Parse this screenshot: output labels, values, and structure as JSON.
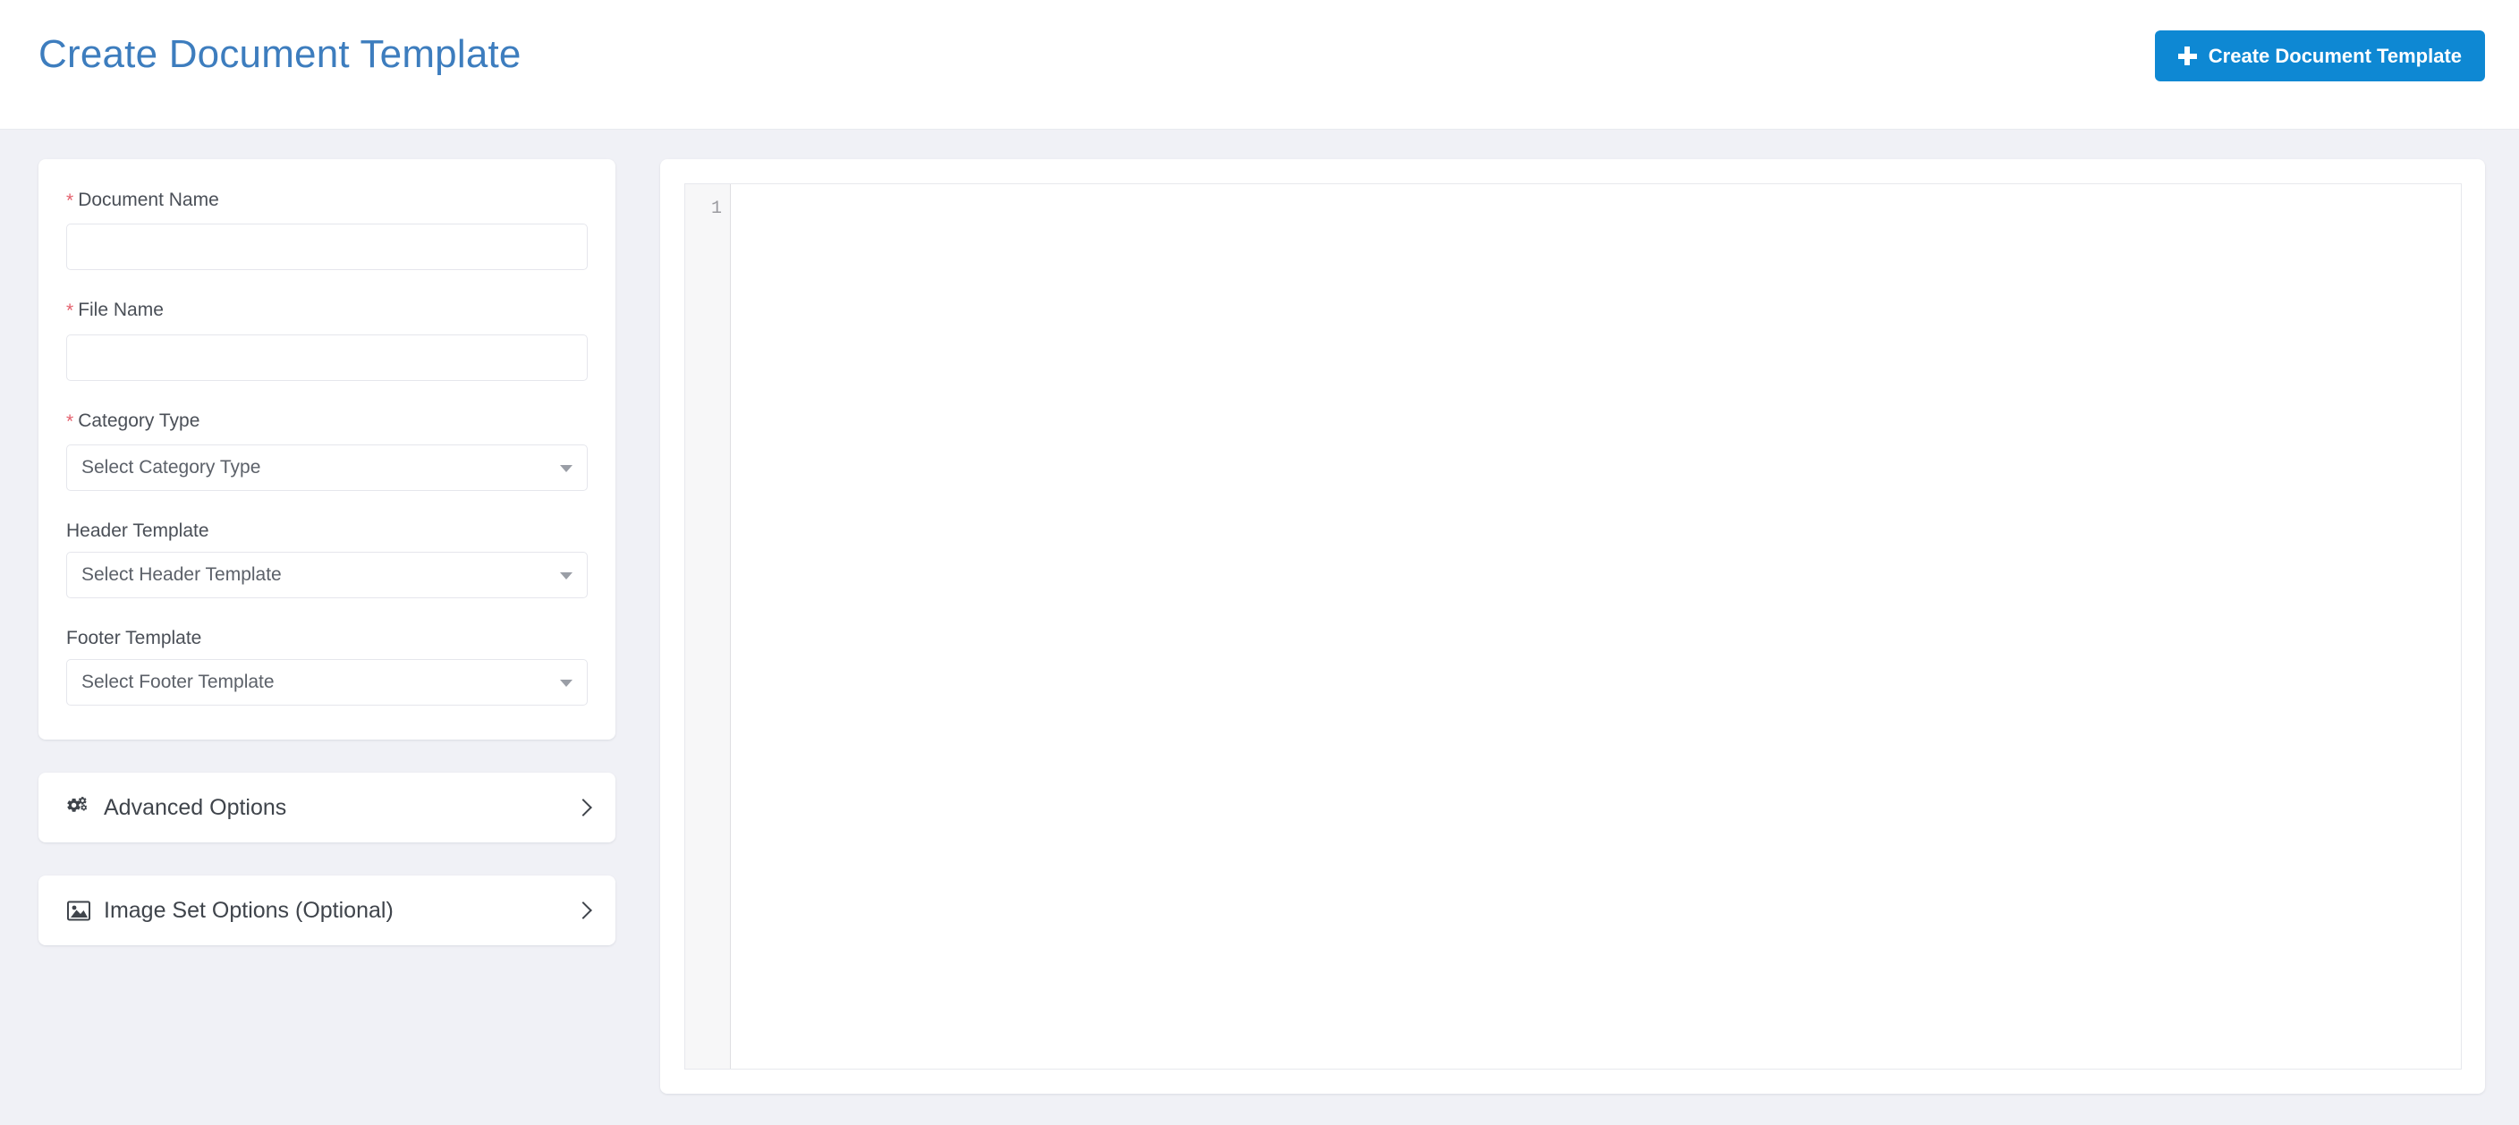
{
  "header": {
    "title": "Create Document Template",
    "action_button": {
      "label": "Create Document Template",
      "icon": "plus-icon",
      "color": "#0e88d3"
    }
  },
  "theme": {
    "page_background": "#f0f1f6",
    "card_background": "#ffffff",
    "title_color": "#3d7dbe",
    "accent": "#0e88d3",
    "required_marker_color": "#e4606d",
    "label_color": "#4a4f57",
    "border_color": "#e5e6ec"
  },
  "form": {
    "fields": [
      {
        "label": "Document Name",
        "required": true,
        "required_marker": "*",
        "type": "text",
        "value": "",
        "placeholder": ""
      },
      {
        "label": "File Name",
        "required": true,
        "required_marker": "*",
        "type": "text",
        "value": "",
        "placeholder": ""
      },
      {
        "label": "Category Type",
        "required": true,
        "required_marker": "*",
        "type": "select",
        "value": "Select Category Type",
        "icon": "chevron-down-icon"
      },
      {
        "label": "Header Template",
        "required": false,
        "required_marker": "",
        "type": "select",
        "value": "Select Header Template",
        "icon": "chevron-down-icon"
      },
      {
        "label": "Footer Template",
        "required": false,
        "required_marker": "",
        "type": "select",
        "value": "Select Footer Template",
        "icon": "chevron-down-icon"
      }
    ]
  },
  "panels": [
    {
      "label": "Advanced Options",
      "icon": "cogs-icon",
      "expand_icon": "chevron-right-icon",
      "expanded": false
    },
    {
      "label": "Image Set Options (Optional)",
      "icon": "image-icon",
      "expand_icon": "chevron-right-icon",
      "expanded": false
    }
  ],
  "editor": {
    "lines": [
      {
        "number": "1",
        "text": ""
      }
    ],
    "content": ""
  }
}
